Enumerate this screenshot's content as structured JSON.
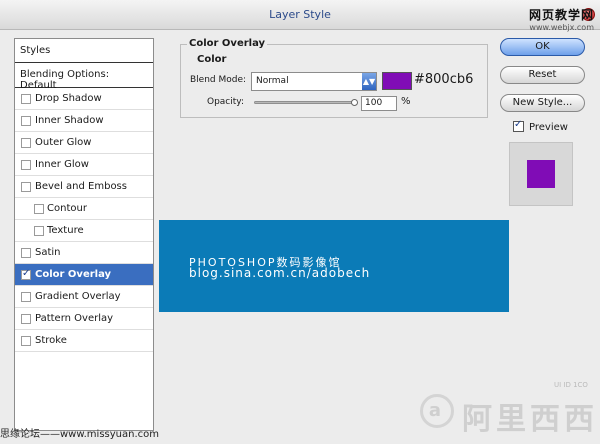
{
  "window": {
    "title": "Layer Style"
  },
  "watermark_top": {
    "line1": "网页教学网",
    "line2": "www.webjx.com"
  },
  "styles_panel": {
    "header": "Styles",
    "blending": "Blending Options: Default",
    "items": [
      {
        "label": "Drop Shadow",
        "checked": false
      },
      {
        "label": "Inner Shadow",
        "checked": false
      },
      {
        "label": "Outer Glow",
        "checked": false
      },
      {
        "label": "Inner Glow",
        "checked": false
      },
      {
        "label": "Bevel and Emboss",
        "checked": false
      },
      {
        "label": "Contour",
        "checked": false
      },
      {
        "label": "Texture",
        "checked": false
      },
      {
        "label": "Satin",
        "checked": false
      },
      {
        "label": "Color Overlay",
        "checked": true
      },
      {
        "label": "Gradient Overlay",
        "checked": false
      },
      {
        "label": "Pattern Overlay",
        "checked": false
      },
      {
        "label": "Stroke",
        "checked": false
      }
    ]
  },
  "color_overlay": {
    "group_title": "Color Overlay",
    "section": "Color",
    "blend_mode_label": "Blend Mode:",
    "blend_mode_value": "Normal",
    "color_hex": "#800cb6",
    "opacity_label": "Opacity:",
    "opacity_value": "100",
    "opacity_unit": "%"
  },
  "banner": {
    "line1": "PHOTOSHOP数码影像馆",
    "line2": "blog.sina.com.cn/adobech",
    "color": "#0b7bb7"
  },
  "buttons": {
    "ok": "OK",
    "reset": "Reset",
    "new_style": "New Style..."
  },
  "preview": {
    "label": "Preview",
    "checked": true
  },
  "watermark_bottom": {
    "left": "思缘论坛——www.missyuan.com",
    "right": "阿里西西",
    "small": "UI ID 1CO"
  }
}
